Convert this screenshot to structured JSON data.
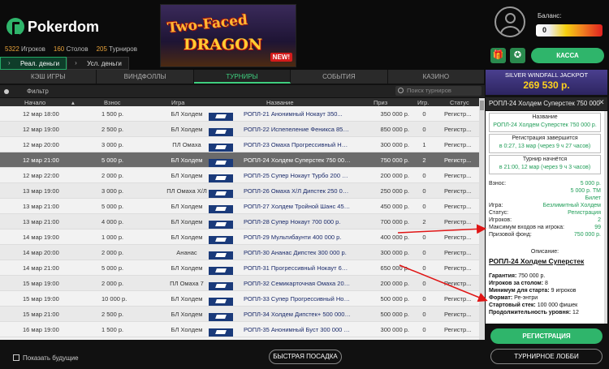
{
  "header": {
    "brand": "Pokerdom",
    "stats": {
      "players_count": "5322",
      "players_label": "Игроков",
      "tables_count": "160",
      "tables_label": "Столов",
      "tourneys_count": "205",
      "tourneys_label": "Турниров"
    },
    "money_tabs": [
      "Реал. деньги",
      "Усл. деньги"
    ],
    "banner": {
      "line1": "Two-Faced",
      "line2": "DRAGON",
      "badge": "NEW!"
    },
    "balance_label": "Баланс:",
    "balance_value": "0",
    "cashier": "КАССА",
    "icons": {
      "gift": "gift-icon",
      "vip": "medal-icon",
      "avatar": "user-icon"
    }
  },
  "tabs": [
    "КЭШ ИГРЫ",
    "ВИНДФОЛЛЫ",
    "ТУРНИРЫ",
    "СОБЫТИЯ",
    "КАЗИНО"
  ],
  "active_tab": "ТУРНИРЫ",
  "filter_label": "Фильтр",
  "search_placeholder": "Поиск турниров",
  "columns": {
    "start": "Начало",
    "buyin": "Взнос",
    "game": "Игра",
    "name": "Название",
    "prize": "Приз",
    "players": "Игр.",
    "status": "Статус"
  },
  "rows": [
    {
      "start": "12 мар 18:00",
      "buyin": "1 500 р.",
      "game": "БЛ Холдем",
      "name": "РОПЛ-21 Анонимный Нокаут 350...",
      "prize": "350 000 р.",
      "players": "0",
      "status": "Регистр..."
    },
    {
      "start": "12 мар 19:00",
      "buyin": "2 500 р.",
      "game": "БЛ Холдем",
      "name": "РОПЛ-22 Испепеление Феникса 850 ...",
      "prize": "850 000 р.",
      "players": "0",
      "status": "Регистр..."
    },
    {
      "start": "12 мар 20:00",
      "buyin": "3 000 р.",
      "game": "ПЛ Омаха",
      "name": "РОПЛ-23 Омаха Прогрессивный Нок...",
      "prize": "300 000 р.",
      "players": "1",
      "status": "Регистр..."
    },
    {
      "start": "12 мар 21:00",
      "buyin": "5 000 р.",
      "game": "БЛ Холдем",
      "name": "РОПЛ-24 Холдем Суперстек 750 000 р.",
      "prize": "750 000 р.",
      "players": "2",
      "status": "Регистр..."
    },
    {
      "start": "12 мар 22:00",
      "buyin": "2 000 р.",
      "game": "БЛ Холдем",
      "name": "РОПЛ-25 Супер Нокаут Турбо 200 000...",
      "prize": "200 000 р.",
      "players": "0",
      "status": "Регистр..."
    },
    {
      "start": "13 мар 19:00",
      "buyin": "3 000 р.",
      "game": "ПЛ Омаха Х/Л",
      "name": "РОПЛ-26 Омаха Х/Л Дипстек 250 000...",
      "prize": "250 000 р.",
      "players": "0",
      "status": "Регистр..."
    },
    {
      "start": "13 мар 21:00",
      "buyin": "5 000 р.",
      "game": "БЛ Холдем",
      "name": "РОПЛ-27 Холдем Тройной Шанс 450 000...",
      "prize": "450 000 р.",
      "players": "0",
      "status": "Регистр..."
    },
    {
      "start": "13 мар 21:00",
      "buyin": "4 000 р.",
      "game": "БЛ Холдем",
      "name": "РОПЛ-28 Супер Нокаут 700 000 р.",
      "prize": "700 000 р.",
      "players": "2",
      "status": "Регистр..."
    },
    {
      "start": "14 мар 19:00",
      "buyin": "1 000 р.",
      "game": "БЛ Холдем",
      "name": "РОПЛ-29 Мультибаунти 400 000 р.",
      "prize": "400 000 р.",
      "players": "0",
      "status": "Регистр..."
    },
    {
      "start": "14 мар 20:00",
      "buyin": "2 000 р.",
      "game": "Ананас",
      "name": "РОПЛ-30 Ананас Дипстек 300 000 р.",
      "prize": "300 000 р.",
      "players": "0",
      "status": "Регистр..."
    },
    {
      "start": "14 мар 21:00",
      "buyin": "5 000 р.",
      "game": "БЛ Холдем",
      "name": "РОПЛ-31 Прогрессивный Нокаут 650 ...",
      "prize": "650 000 р.",
      "players": "0",
      "status": "Регистр..."
    },
    {
      "start": "15 мар 19:00",
      "buyin": "2 000 р.",
      "game": "ПЛ Омаха 7",
      "name": "РОПЛ-32 Семикарточная Омаха 200 000...",
      "prize": "200 000 р.",
      "players": "0",
      "status": "Регистр..."
    },
    {
      "start": "15 мар 19:00",
      "buyin": "10 000 р.",
      "game": "БЛ Холдем",
      "name": "РОПЛ-33 Супер Прогрессивный Нок...",
      "prize": "500 000 р.",
      "players": "0",
      "status": "Регистр..."
    },
    {
      "start": "15 мар 21:00",
      "buyin": "2 500 р.",
      "game": "БЛ Холдем",
      "name": "РОПЛ-34 Холдем Дипстек+ 500 000 р.",
      "prize": "500 000 р.",
      "players": "0",
      "status": "Регистр..."
    },
    {
      "start": "16 мар 19:00",
      "buyin": "1 500 р.",
      "game": "БЛ Холдем",
      "name": "РОПЛ-35 Анонимный Буст 300 000 р...",
      "prize": "300 000 р.",
      "players": "0",
      "status": "Регистр..."
    }
  ],
  "selected_row": 3,
  "show_future": "Показать будущие",
  "quick_seat": "БЫСТРАЯ ПОСАДКА",
  "jackpot": {
    "title": "SILVER WINDFALL JACKPOT",
    "value": "269 530 р."
  },
  "details": {
    "title": "РОПЛ-24 Холдем Суперстек 750 000",
    "name_label": "Название",
    "name_value": "РОПЛ-24 Холдем Суперстек 750 000 р.",
    "reg_end_label": "Регистрация завершится",
    "reg_end_value": "в 0:27, 13 мар (через 9 ч 27 часов)",
    "start_label": "Турнир начнётся",
    "start_value": "в 21:00, 12 мар (через 9 ч 3 часов)",
    "buyin_label": "Взнос:",
    "buyin_values": [
      "5 000 р.",
      "5 000 р. ТМ",
      "Билет"
    ],
    "game_label": "Игра:",
    "game_value": "Безлимитный Холдем",
    "status_label": "Статус:",
    "status_value": "Регистрация",
    "players_label": "Игроков:",
    "players_value": "2",
    "max_label": "Максимум входов на игрока:",
    "max_value": "99",
    "prize_label": "Призовой фонд:",
    "prize_value": "750 000 р.",
    "desc_label": "Описание:",
    "desc_title": "РОПЛ-24 Холдем Суперстек",
    "lines": [
      {
        "k": "Гарантия:",
        "v": "750 000 р."
      },
      {
        "k": "Игроков за столом:",
        "v": "8"
      },
      {
        "k": "Минимум для старта:",
        "v": "9 игроков"
      },
      {
        "k": "Формат:",
        "v": "Ре-энтри"
      },
      {
        "k": "Стартовый стек:",
        "v": "100 000 фишек"
      },
      {
        "k": "Продолжительность уровня:",
        "v": "12"
      }
    ],
    "register": "РЕГИСТРАЦИЯ",
    "lobby": "ТУРНИРНОЕ ЛОББИ"
  },
  "colors": {
    "accent": "#2fb56b",
    "jackpot": "#ffd21c",
    "arrow": "#e01515"
  }
}
